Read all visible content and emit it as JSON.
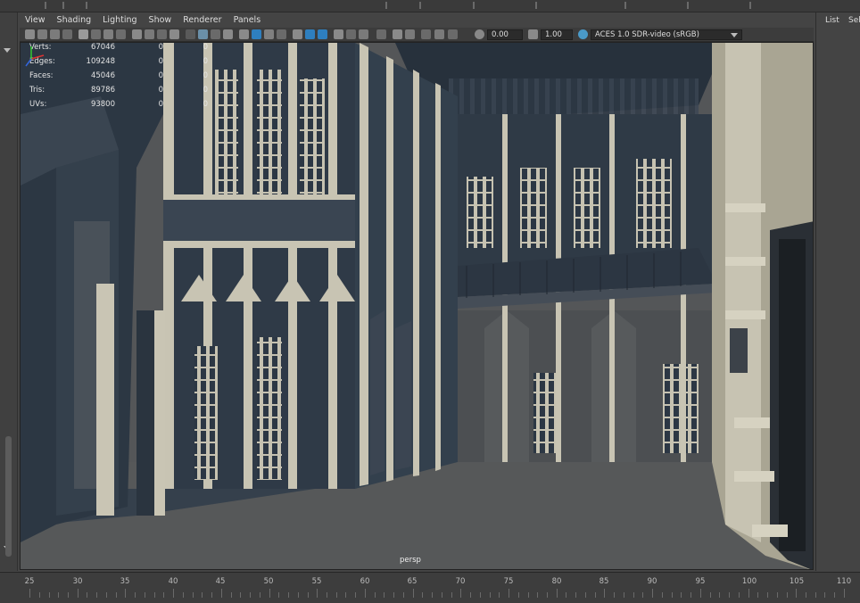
{
  "menubar": {
    "items": [
      "View",
      "Shading",
      "Lighting",
      "Show",
      "Renderer",
      "Panels"
    ]
  },
  "toolbar": {
    "exposure_value": "0.00",
    "gamma_value": "1.00",
    "view_transform": "ACES 1.0 SDR-video (sRGB)",
    "icons": [
      "camera-select-icon",
      "camera-attributes-icon",
      "bookmark-icon",
      "image-plane-icon",
      "grid-icon",
      "film-gate-icon",
      "resolution-gate-icon",
      "field-chart-icon",
      "safe-action-icon",
      "safe-title-icon",
      "wireframe-icon",
      "smooth-shade-icon",
      "default-material-icon",
      "textured-icon",
      "use-all-lights-icon",
      "shadows-icon",
      "ambient-occlusion-icon",
      "motion-blur-icon",
      "anti-aliasing-icon",
      "depth-of-field-icon",
      "isolate-select-icon",
      "xray-icon",
      "xray-active-icon",
      "xray-joints-icon"
    ]
  },
  "hud": {
    "rows": [
      {
        "label": "Verts:",
        "v1": "67046",
        "v2": "0",
        "v3": "0"
      },
      {
        "label": "Edges:",
        "v1": "109248",
        "v2": "0",
        "v3": "0"
      },
      {
        "label": "Faces:",
        "v1": "45046",
        "v2": "0",
        "v3": "0"
      },
      {
        "label": "Tris:",
        "v1": "89786",
        "v2": "0",
        "v3": "0"
      },
      {
        "label": "UVs:",
        "v1": "93800",
        "v2": "0",
        "v3": "0"
      }
    ]
  },
  "viewport": {
    "camera_name": "persp"
  },
  "right_panel": {
    "items": [
      "List",
      "Sele"
    ]
  },
  "timeline": {
    "labels": [
      "25",
      "30",
      "35",
      "40",
      "45",
      "50",
      "55",
      "60",
      "65",
      "70",
      "75",
      "80",
      "85",
      "90",
      "95",
      "100",
      "105",
      "110"
    ]
  },
  "colors": {
    "stone_light": "#c9c5b4",
    "stone_shadow": "#2f3a47",
    "floor": "#545658",
    "accent_blue": "#2e7fbf"
  }
}
